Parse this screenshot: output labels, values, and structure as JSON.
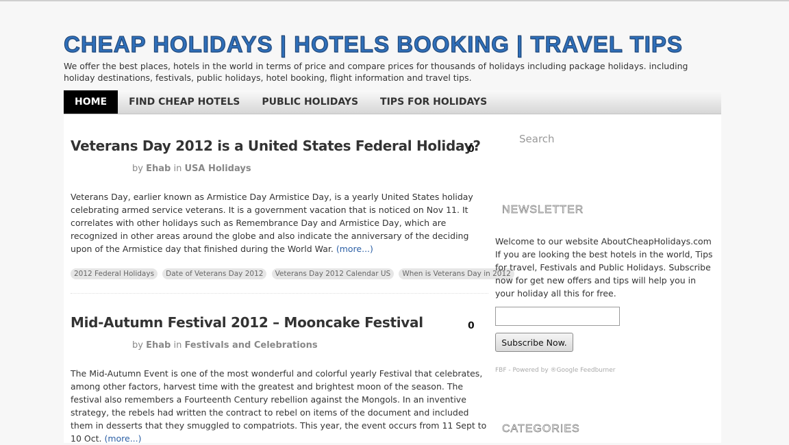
{
  "site": {
    "title": "CHEAP HOLIDAYS | HOTELS BOOKING | TRAVEL TIPS",
    "description": "We offer the best places, hotels in the world in terms of price and compare prices for thousands of holidays including package holidays. including holiday destinations, festivals, public holidays, hotel booking, flight information and travel tips."
  },
  "nav": {
    "items": [
      {
        "label": "HOME"
      },
      {
        "label": "FIND CHEAP HOTELS"
      },
      {
        "label": "PUBLIC HOLIDAYS"
      },
      {
        "label": "TIPS FOR HOLIDAYS"
      }
    ]
  },
  "posts": [
    {
      "title": "Veterans Day 2012 is a United States Federal Holiday?",
      "comments": "0",
      "by": "by",
      "author": "Ehab",
      "in": "in",
      "category": "USA Holidays",
      "excerpt": "Veterans Day, earlier known as Armistice Day Armistice Day, is a yearly United States holiday celebrating armed service veterans. It is a government vacation that is noticed on Nov 11. It correlates with other holidays such as Remembrance Day and Armistice Day, which are recognized in other areas around the globe and also indicate the anniversary of the deciding upon of the Armistice day that finished during the World War.",
      "more": "(more...)",
      "tags": [
        "2012 Federal Holidays",
        "Date of Veterans Day 2012",
        "Veterans Day 2012 Calendar US",
        "When is Veterans Day in 2012"
      ]
    },
    {
      "title": "Mid-Autumn Festival 2012 – Mooncake Festival",
      "comments": "0",
      "by": "by",
      "author": "Ehab",
      "in": "in",
      "category": "Festivals and Celebrations",
      "excerpt": "The Mid-Autumn Event is one of the most wonderful and colorful yearly Festival that celebrates, among other factors, harvest time with the greatest and brightest moon of the season. The festival also remembers a Fourteenth Century rebellion against the Mongols. In an inventive strategy, the rebels had written the contract to rebel on items of the document and included them in desserts that they smuggled to compatriots. This year, the event occurs from 11 Sept to 10 Oct.",
      "more": "(more...)"
    }
  ],
  "sidebar": {
    "search_placeholder": "Search",
    "newsletter_title": "NEWSLETTER",
    "newsletter_text": "Welcome to our website AboutCheapHolidays.com If you are looking the best hotels in the world, Tips for travel, Festivals and Public Holidays. Subscribe now for get new offers and tips will help you in your holiday all this for free.",
    "subscribe_label": "Subscribe Now.",
    "powered": "FBF - Powered by ®Google Feedburner",
    "categories_title": "CATEGORIES"
  },
  "colors": {
    "title_blue": "#2f6fb9",
    "link_blue": "#2b5fa5",
    "nav_active": "#000000"
  }
}
